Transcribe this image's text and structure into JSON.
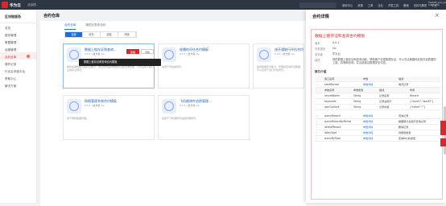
{
  "topbar": {
    "brand": "华为云",
    "region": "北京四",
    "links": [
      "费用中心",
      "资源",
      "工单",
      "企业",
      "开发工具",
      "备案",
      "支持与服务",
      "中文"
    ],
    "user_line1": "hwstaff_pub_jiaoshi01",
    "user_line2": "add/invite"
  },
  "sidebar": {
    "title": "区块链服务",
    "items": [
      {
        "label": "总览"
      },
      {
        "label": "服务管理"
      },
      {
        "label": "联盟管理"
      },
      {
        "label": "运营管理"
      },
      {
        "label": "合约仓库",
        "active": true,
        "badge": true
      },
      {
        "label": "操作记录"
      },
      {
        "label": "行业区块链平台"
      },
      {
        "label": "帮助中心"
      },
      {
        "label": "解决方案"
      }
    ]
  },
  "main": {
    "title": "合约仓库",
    "tabs": [
      "合约仓库",
      "我的已发布合约"
    ],
    "filters": [
      "全部",
      "政务",
      "金融",
      "溯源"
    ],
    "tooltip": "数据上链存证和查询合约模板",
    "cards": [
      {
        "name": "数据上链存证和查询…",
        "meta1": "0.0.1 | 发布者 Go",
        "meta2": "华为云",
        "desc": "构建基础数据上链存证能力，通过合约提供数据存证和查询功能，可以应用于各行业的存证场景。",
        "btn": "部署"
      },
      {
        "name": "轮播的评估合约模板",
        "meta1": "0.0.1 | 发布者 Go",
        "meta2": "华为云",
        "desc": "适用于评估类场景。",
        "btn": "部署"
      },
      {
        "name": "旅开通能行评估合约模板",
        "meta1": "0.0.1 | 发布者 Go",
        "meta2": "华为云",
        "desc": "提供数据存证能力，管理和查询存证数据，可以应用于出行评估场景。",
        "btn": "部署"
      },
      {
        "name": "网格管理系统合约模板",
        "meta1": "0.0.1 | 发布者 Go",
        "meta2": "华为云",
        "desc": "用于网格数据管理。",
        "btn": "部署"
      },
      {
        "name": "飞机维修件追踪管理…",
        "meta1": "0.0.1 | 发布者 Go",
        "meta2": "华为云",
        "desc": "适用于飞机维修件追踪管理场景。",
        "btn": "部署"
      }
    ],
    "secondary_btn": "详情"
  },
  "drawer": {
    "header": "合约详情",
    "title": "数据上链存证和查询合约模板",
    "fields": [
      {
        "k": "版本",
        "v": "0.0.1"
      },
      {
        "k": "开发语言",
        "v": "Go"
      },
      {
        "k": "发布者",
        "v": "华为云"
      },
      {
        "k": "描述",
        "v": "提供数据上链存证和查询功能，帮助客户实现数据存证，可以灵活便捷地实现存证数据的上链、存储和查询，并且能保证数据安全可靠。"
      }
    ],
    "interface_title": "接口介绍",
    "cols": [
      "接口名称",
      "参数",
      "描述"
    ],
    "methods": [
      {
        "name": "saveRecord",
        "link": "参数详情",
        "desc": "保存记录",
        "expanded": true,
        "params": [
          {
            "name": "recordName",
            "type": "String",
            "desc": "记录名称",
            "example": "Record"
          },
          {
            "name": "keywords",
            "type": "String",
            "desc": "记录关键字",
            "example": "{\"word1\",\"word2\"}"
          },
          {
            "name": "jsonContent",
            "type": "String",
            "desc": "记录内容",
            "example": "{\"name\":\"\"}"
          }
        ]
      },
      {
        "name": "queryRecord",
        "link": "参数详情",
        "desc": "查询记录"
      },
      {
        "name": "queryRecordByPartial",
        "link": "参数详情",
        "desc": "根据部分关键字查询记录"
      },
      {
        "name": "deleteRecord",
        "link": "参数详情",
        "desc": "删除记录"
      },
      {
        "name": "isKeyType",
        "link": "参数详情",
        "desc": "判断键类型"
      },
      {
        "name": "queryByType",
        "link": "参数详情",
        "desc": "查询Key的类型"
      }
    ],
    "param_cols": [
      "参数名称",
      "参数类型",
      "描述",
      "样例"
    ]
  }
}
